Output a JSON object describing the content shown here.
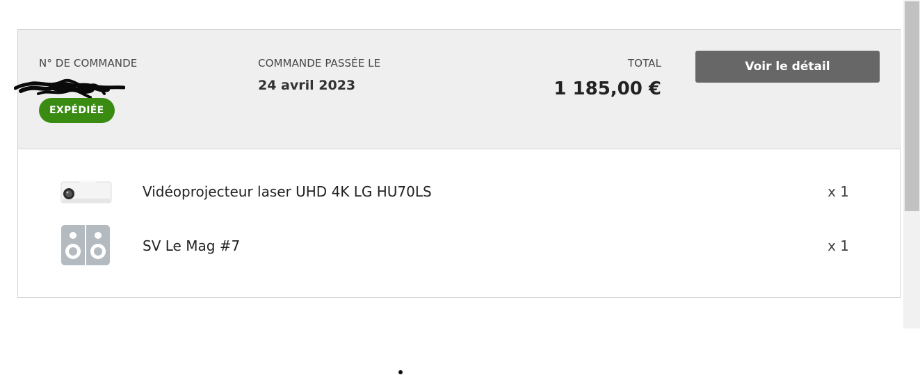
{
  "order": {
    "number_label": "N° DE COMMANDE",
    "date_label": "COMMANDE PASSÉE LE",
    "date": "24 avril 2023",
    "total_label": "TOTAL",
    "total": "1 185,00 €",
    "status": "EXPÉDIÉE",
    "detail_button": "Voir le détail"
  },
  "items": [
    {
      "name": "Vidéoprojecteur laser UHD 4K LG HU70LS",
      "quantity": "x 1",
      "icon": "projector-icon"
    },
    {
      "name": "SV Le Mag #7",
      "quantity": "x 1",
      "icon": "speakers-icon"
    }
  ],
  "colors": {
    "header_bg": "#efefef",
    "status_green": "#3a8b12",
    "button_grey": "#676767",
    "border": "#d4d4d4"
  }
}
